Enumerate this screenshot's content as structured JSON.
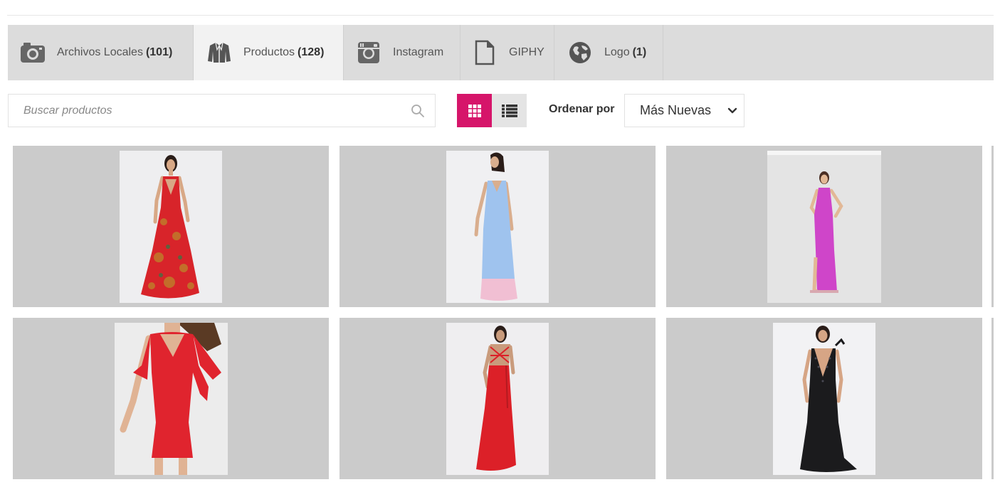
{
  "tabs": [
    {
      "label": "Archivos Locales",
      "count": "(101)",
      "icon": "camera-icon",
      "active": false
    },
    {
      "label": "Productos",
      "count": "(128)",
      "icon": "jacket-icon",
      "active": true
    },
    {
      "label": "Instagram",
      "count": "",
      "icon": "instagram-icon",
      "active": false
    },
    {
      "label": "GIPHY",
      "count": "",
      "icon": "file-icon",
      "active": false
    },
    {
      "label": "Logo",
      "count": "(1)",
      "icon": "globe-icon",
      "active": false
    }
  ],
  "search": {
    "placeholder": "Buscar productos",
    "value": ""
  },
  "sort": {
    "label": "Ordenar por",
    "selected": "Más Nuevas"
  },
  "colors": {
    "accent": "#d6156a",
    "tab_bar": "#dcdcdc",
    "card_bg": "#cbcbcb"
  },
  "products": [
    {
      "dress": "red floral maxi dress",
      "color": "#d8242a"
    },
    {
      "dress": "light blue slip dress with pink hem",
      "color": "#9fc3ee"
    },
    {
      "dress": "magenta mermaid dress",
      "color": "#cf45c9"
    },
    {
      "dress": "red mini dress",
      "color": "#e0242e"
    },
    {
      "dress": "red backless gown",
      "color": "#dc2028"
    },
    {
      "dress": "black sequin gown",
      "color": "#1b1b1d"
    }
  ]
}
